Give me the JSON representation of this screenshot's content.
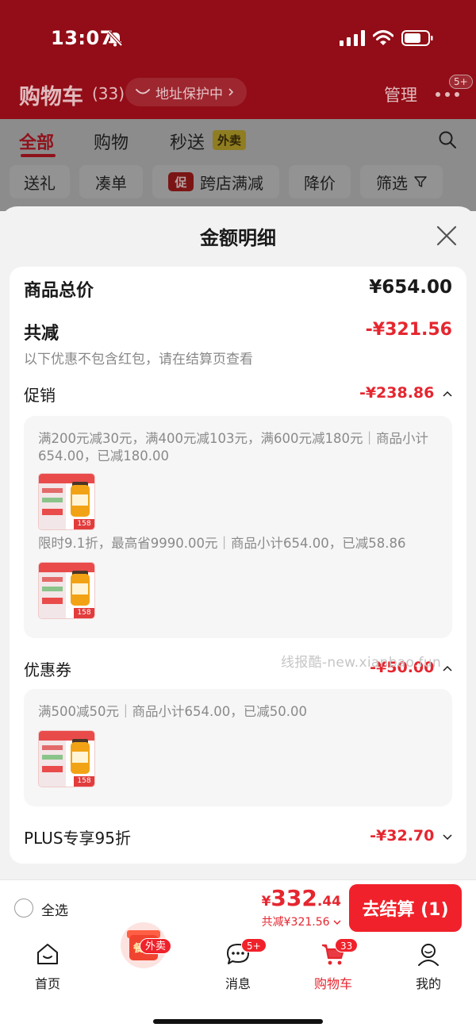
{
  "status_bar": {
    "time": "13:07"
  },
  "header": {
    "title": "购物车",
    "count": "(33)",
    "address_pill": "地址保护中",
    "manage": "管理",
    "more_badge": "5+"
  },
  "tabs": {
    "all": "全部",
    "shopping": "购物",
    "instant": "秒送",
    "instant_tag": "外卖"
  },
  "filters": {
    "gift": "送礼",
    "bundle": "凑单",
    "promo_icon": "促",
    "cross_store": "跨店满减",
    "price_drop": "降价",
    "screen": "筛选"
  },
  "sheet": {
    "title": "金额明细",
    "total_label": "商品总价",
    "total_value": "¥654.00",
    "reduce_label": "共减",
    "reduce_value": "-¥321.56",
    "reduce_note": "以下优惠不包含红包，请在结算页查看",
    "promo_label": "促销",
    "promo_value": "-¥238.86",
    "promo_lines": [
      "满200元减30元，满400元减103元，满600元减180元｜商品小计654.00，已减180.00",
      "限时9.1折，最高省9990.00元｜商品小计654.00，已减58.86"
    ],
    "coupon_label": "优惠券",
    "coupon_value": "-¥50.00",
    "coupon_line": "满500减50元｜商品小计654.00，已减50.00",
    "plus_label": "PLUS专享95折",
    "plus_value": "-¥32.70",
    "thumb_price": "158"
  },
  "watermark": "线报酷-new.xianbao.fun",
  "checkout": {
    "select_all": "全选",
    "yen": "¥",
    "price_int": "332",
    "price_dec": ".44",
    "discount": "共减¥321.56",
    "button": "去结算 (1)"
  },
  "tabbar": {
    "home": "首页",
    "waimai_badge": "外卖",
    "hongbao_text": "餐补",
    "messages": "消息",
    "messages_badge": "5+",
    "cart": "购物车",
    "cart_badge": "33",
    "me": "我的"
  },
  "colors": {
    "accent_red": "#e5262f",
    "header_dim_red": "#920d17",
    "overlay_gray": "#8c8c8c"
  }
}
